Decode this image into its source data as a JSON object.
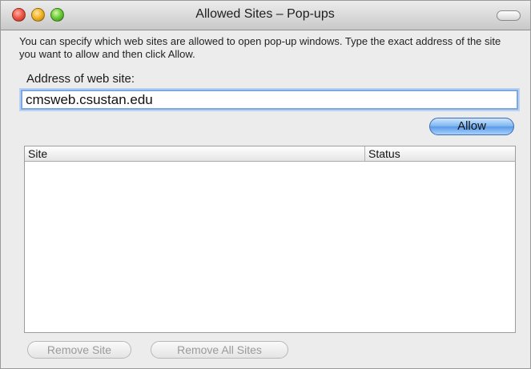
{
  "window": {
    "title": "Allowed Sites – Pop-ups"
  },
  "dialog": {
    "description": "You can specify which web sites are allowed to open pop-up windows. Type the exact address of the site you want to allow and then click Allow.",
    "address_label": "Address of web site:",
    "address_value": "cmsweb.csustan.edu",
    "allow_label": "Allow"
  },
  "table": {
    "columns": [
      "Site",
      "Status"
    ],
    "rows": []
  },
  "buttons": {
    "remove_site": "Remove Site",
    "remove_all_sites": "Remove All Sites"
  },
  "colors": {
    "accent": "#6aa6ec",
    "focus_ring": "#7fa8e3",
    "disabled_text": "#9a9a9a"
  }
}
